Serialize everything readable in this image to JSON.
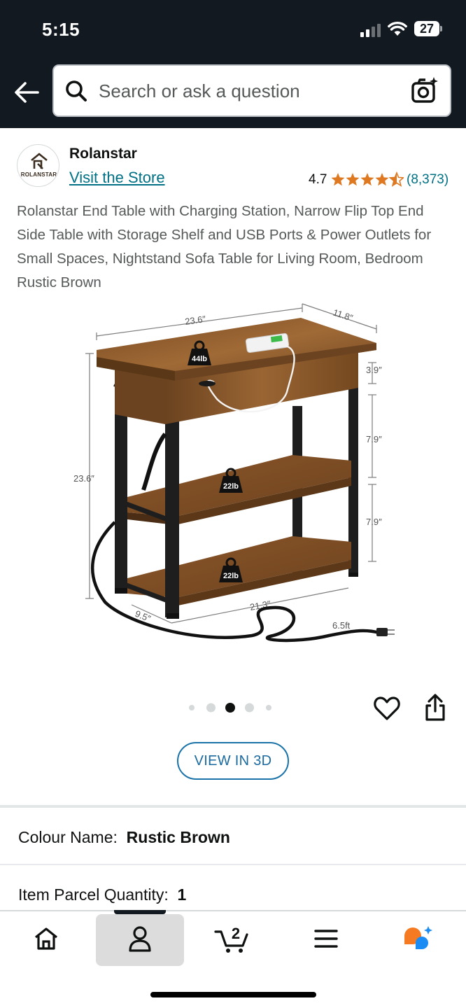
{
  "status_bar": {
    "time": "5:15",
    "battery": "27"
  },
  "search": {
    "placeholder": "Search or ask a question"
  },
  "brand": {
    "name": "Rolanstar",
    "logo_text": "ROLANSTAR",
    "store_link": "Visit the Store"
  },
  "rating": {
    "value": "4.7",
    "stars": 4.5,
    "count": "(8,373)"
  },
  "product": {
    "title": "Rolanstar End Table with Charging Station, Narrow Flip Top End Side Table with Storage Shelf and USB Ports & Power Outlets for Small Spaces, Nightstand Sofa Table for Living Room, Bedroom Rustic Brown",
    "image_labels": {
      "width_top": "23.6″",
      "depth_top": "11.8″",
      "height_total": "23.6″",
      "drawer_height": "3.9″",
      "shelf_gap_1": "7.9″",
      "shelf_gap_2": "7.9″",
      "depth_bottom": "9.5″",
      "width_bottom": "21.3″",
      "cord_length": "6.5ft",
      "top_load": "44lb",
      "middle_load": "22lb",
      "bottom_load": "22lb"
    }
  },
  "carousel": {
    "total": 5,
    "active_index": 2
  },
  "view_3d_label": "VIEW IN 3D",
  "attributes": [
    {
      "label": "Colour Name:",
      "value": "Rustic Brown"
    },
    {
      "label": "Item Parcel Quantity:",
      "value": "1"
    }
  ],
  "bottom_nav": {
    "items": [
      "home-icon",
      "account-icon",
      "cart-icon",
      "menu-icon",
      "rufus-icon"
    ],
    "active": "account-icon",
    "cart_count": "2"
  },
  "colors": {
    "header_bg": "#131921",
    "link": "#007185",
    "star": "#de7921",
    "wood": "#8b5a2b",
    "metal": "#1e1e1e",
    "rufus_orange": "#f57a22",
    "rufus_blue": "#1b8cf3"
  }
}
